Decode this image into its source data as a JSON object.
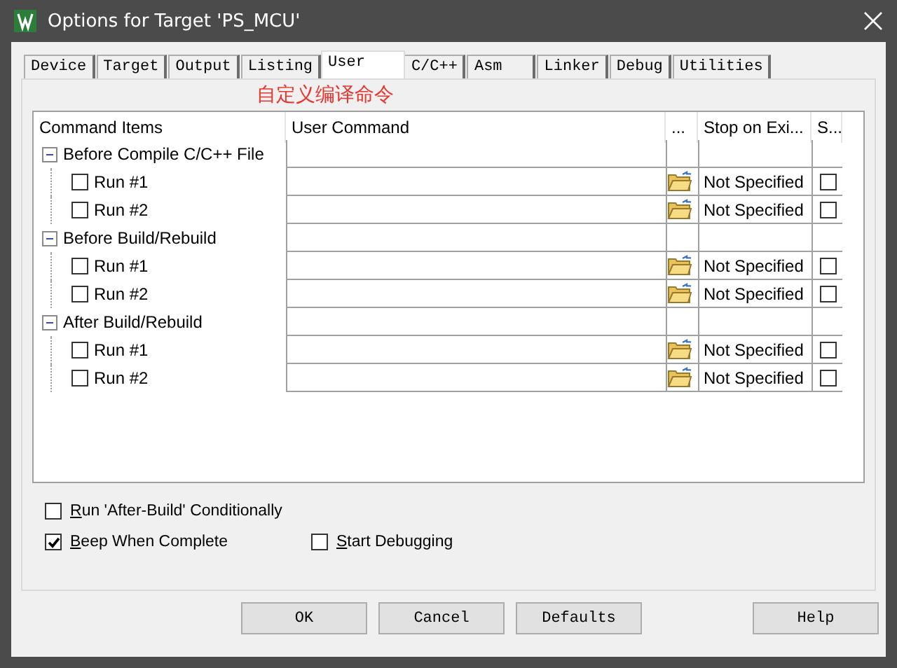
{
  "window": {
    "title": "Options for Target 'PS_MCU'"
  },
  "tabs": [
    {
      "label": "Device",
      "selected": false
    },
    {
      "label": "Target",
      "selected": false
    },
    {
      "label": "Output",
      "selected": false
    },
    {
      "label": "Listing",
      "selected": false
    },
    {
      "label": "User",
      "selected": true
    },
    {
      "label": "C/C++",
      "selected": false
    },
    {
      "label": "Asm",
      "selected": false
    },
    {
      "label": "Linker",
      "selected": false
    },
    {
      "label": "Debug",
      "selected": false
    },
    {
      "label": "Utilities",
      "selected": false
    }
  ],
  "annotation": "自定义编译命令",
  "table": {
    "columns": [
      "Command Items",
      "User Command",
      "...",
      "Stop on Exi...",
      "S..."
    ],
    "groups": [
      {
        "label": "Before Compile C/C++ File",
        "expanded": true,
        "children": [
          {
            "label": "Run #1",
            "checked": false,
            "stop_on_exit": "Not Specified",
            "column_5_checked": false
          },
          {
            "label": "Run #2",
            "checked": false,
            "stop_on_exit": "Not Specified",
            "column_5_checked": false
          }
        ]
      },
      {
        "label": "Before Build/Rebuild",
        "expanded": true,
        "children": [
          {
            "label": "Run #1",
            "checked": false,
            "stop_on_exit": "Not Specified",
            "column_5_checked": false
          },
          {
            "label": "Run #2",
            "checked": false,
            "stop_on_exit": "Not Specified",
            "column_5_checked": false
          }
        ]
      },
      {
        "label": "After Build/Rebuild",
        "expanded": true,
        "children": [
          {
            "label": "Run #1",
            "checked": false,
            "stop_on_exit": "Not Specified",
            "column_5_checked": false
          },
          {
            "label": "Run #2",
            "checked": false,
            "stop_on_exit": "Not Specified",
            "column_5_checked": false
          }
        ]
      }
    ]
  },
  "options": [
    [
      {
        "label": "Run 'After-Build' Conditionally",
        "checked": false
      }
    ],
    [
      {
        "label": "Beep When Complete",
        "checked": true
      },
      {
        "label": "Start Debugging",
        "checked": false
      }
    ]
  ],
  "buttons": [
    "OK",
    "Cancel",
    "Defaults",
    "Help"
  ]
}
